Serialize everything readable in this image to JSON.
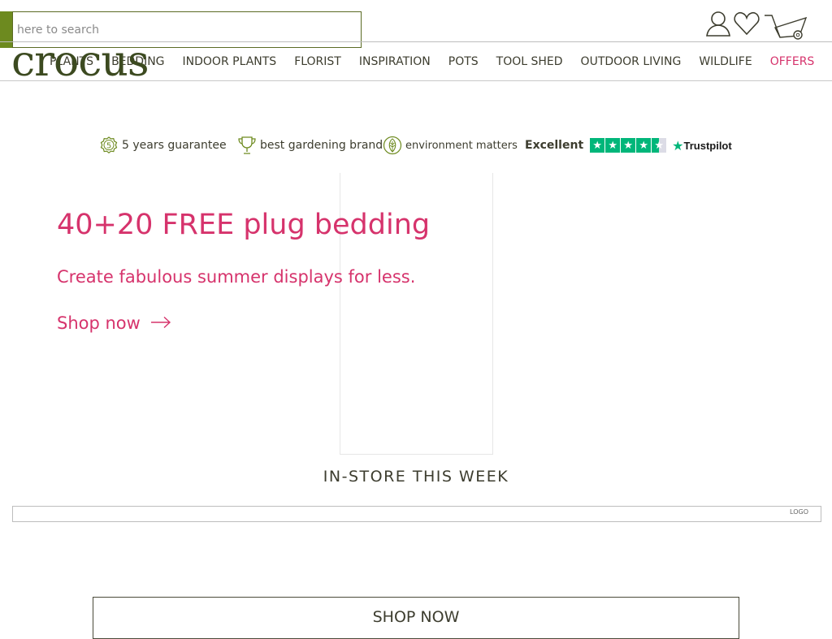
{
  "header": {
    "search": {
      "placeholder": "here to search",
      "value": ""
    },
    "logo_text": "crocus",
    "icons": [
      "account-icon",
      "wishlist-heart-icon",
      "basket-wheelbarrow-icon"
    ]
  },
  "nav": {
    "items": [
      {
        "label": "PLANTS"
      },
      {
        "label": "BEDDING"
      },
      {
        "label": "INDOOR PLANTS"
      },
      {
        "label": "FLORIST"
      },
      {
        "label": "INSPIRATION"
      },
      {
        "label": "POTS"
      },
      {
        "label": "TOOL SHED"
      },
      {
        "label": "OUTDOOR LIVING"
      },
      {
        "label": "WILDLIFE"
      },
      {
        "label": "OFFERS"
      }
    ]
  },
  "trust_bar": {
    "guarantee_label": "5 years guarantee",
    "guarantee_badge": "5",
    "brand_label": "best gardening brand",
    "environment_label": "environment matters",
    "trustpilot": {
      "rating_text": "Excellent",
      "stars": 4.5,
      "brand": "Trustpilot"
    }
  },
  "hero": {
    "title": "40+20 FREE plug bedding",
    "subtitle": "Create fabulous summer displays for less.",
    "cta_label": "Shop now"
  },
  "in_store": {
    "title": "IN-STORE THIS WEEK",
    "carousel_tag": "LOGO"
  },
  "shop_now_button": "SHOP NOW",
  "colors": {
    "brand_green": "#6d8a1f",
    "logo_green": "#3c4a20",
    "accent_pink": "#d6336c",
    "trustpilot_green": "#00b67a"
  }
}
